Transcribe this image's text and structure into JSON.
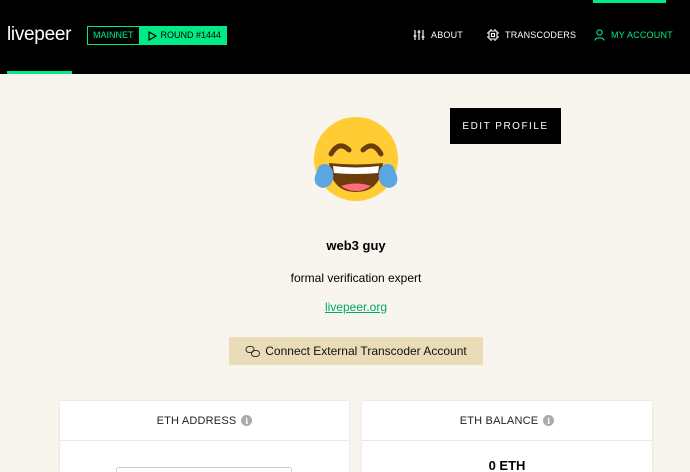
{
  "header": {
    "logo": "livepeer",
    "network": "MAINNET",
    "round": "ROUND #1444",
    "nav": {
      "about": "ABOUT",
      "transcoders": "TRANSCODERS",
      "my_account": "MY ACCOUNT"
    },
    "accent_color": "#00eb88"
  },
  "profile": {
    "edit_label": "EDIT PROFILE",
    "avatar": "face-with-tears-of-joy-emoji",
    "name": "web3 guy",
    "bio": "formal verification expert",
    "website": "livepeer.org",
    "connect_label": "Connect External Transcoder Account"
  },
  "cards": {
    "address_title": "ETH ADDRESS",
    "balance_title": "ETH BALANCE",
    "balance_value": "0 ETH"
  },
  "icons": {
    "info": "i"
  }
}
